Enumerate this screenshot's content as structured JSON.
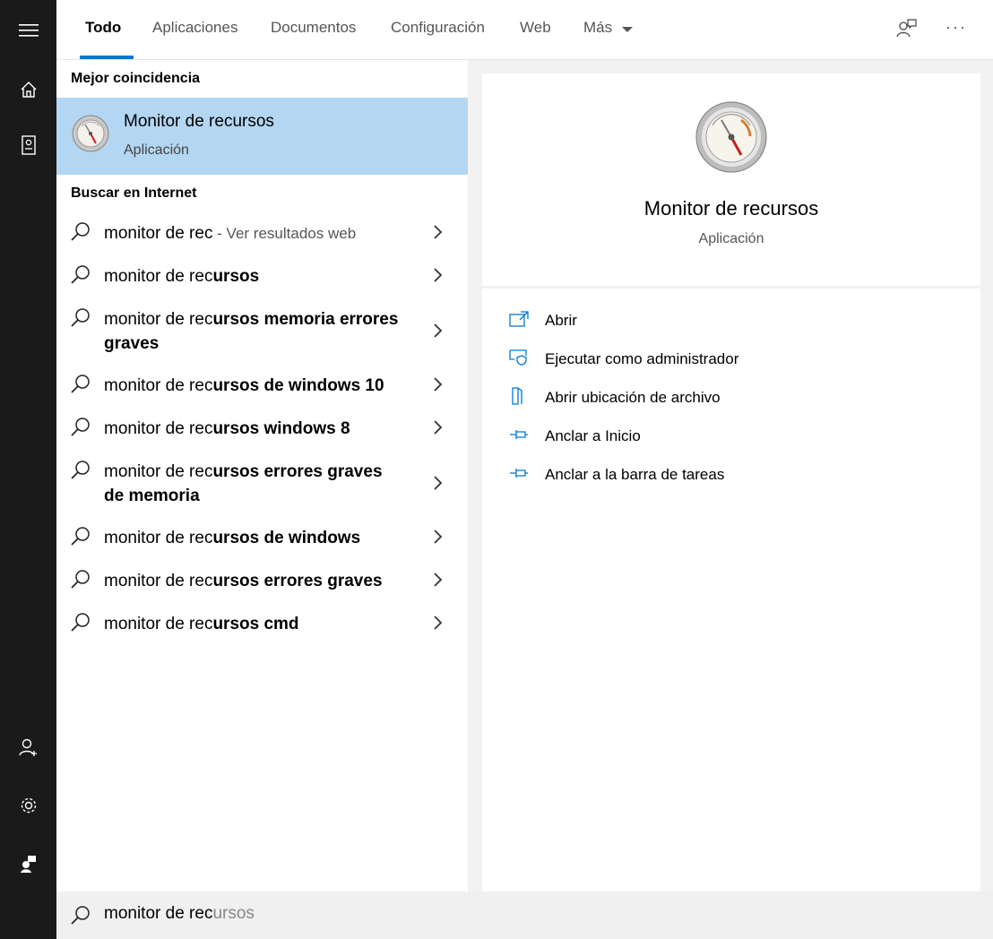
{
  "tabs": [
    {
      "label": "Todo",
      "active": true
    },
    {
      "label": "Aplicaciones"
    },
    {
      "label": "Documentos"
    },
    {
      "label": "Configuración"
    },
    {
      "label": "Web"
    },
    {
      "label": "Más"
    }
  ],
  "left_panel": {
    "best_match_title": "Mejor coincidencia",
    "best_match": {
      "name": "Monitor de recursos",
      "type": "Aplicación"
    },
    "web_title": "Buscar en Internet",
    "suggestions": [
      {
        "plain": "monitor de rec",
        "bold": "",
        "hint": " - Ver resultados web"
      },
      {
        "plain": "monitor de rec",
        "bold": "ursos",
        "hint": ""
      },
      {
        "plain": "monitor de rec",
        "bold": "ursos memoria errores graves",
        "hint": ""
      },
      {
        "plain": "monitor de rec",
        "bold": "ursos de windows 10",
        "hint": ""
      },
      {
        "plain": "monitor de rec",
        "bold": "ursos windows 8",
        "hint": ""
      },
      {
        "plain": "monitor de rec",
        "bold": "ursos errores graves de memoria",
        "hint": ""
      },
      {
        "plain": "monitor de rec",
        "bold": "ursos de windows",
        "hint": ""
      },
      {
        "plain": "monitor de rec",
        "bold": "ursos errores graves",
        "hint": ""
      },
      {
        "plain": "monitor de rec",
        "bold": "ursos cmd",
        "hint": ""
      }
    ]
  },
  "preview": {
    "name": "Monitor de recursos",
    "type": "Aplicación",
    "actions": [
      {
        "label": "Abrir",
        "icon": "open-icon"
      },
      {
        "label": "Ejecutar como administrador",
        "icon": "shield-icon"
      },
      {
        "label": "Abrir ubicación de archivo",
        "icon": "file-location-icon"
      },
      {
        "label": "Anclar a Inicio",
        "icon": "pin-icon"
      },
      {
        "label": "Anclar a la barra de tareas",
        "icon": "pin-icon"
      }
    ]
  },
  "search": {
    "typed": "monitor de rec",
    "autocomplete": "ursos"
  },
  "colors": {
    "accent": "#0078d7",
    "selection": "#b3d6f2",
    "rail": "#1a1a1a"
  }
}
